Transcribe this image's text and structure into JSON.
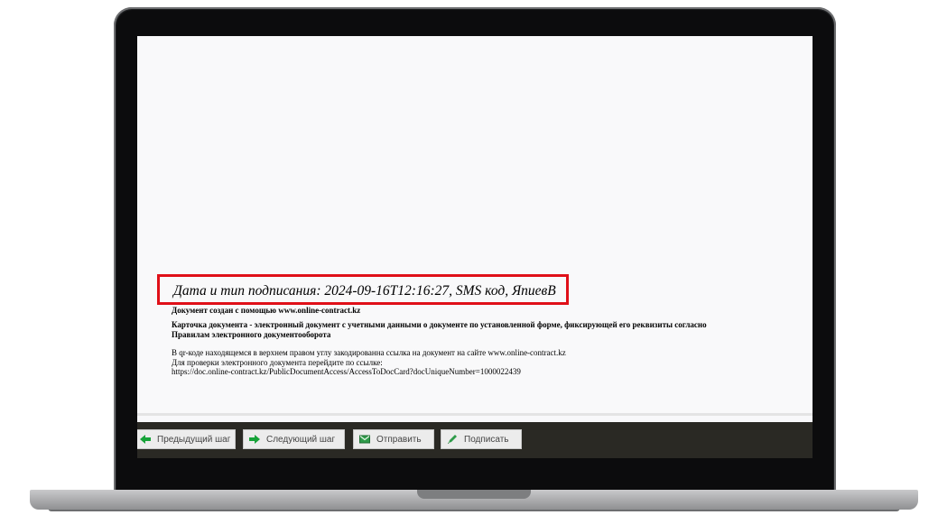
{
  "document": {
    "signature_line": "Дата и тип подписания: 2024-09-16T12:16:27, SMS код, ЯпиевВ",
    "created_with": "Документ создан с помощью www.online-contract.kz",
    "card_description_1": "Карточка документа - электронный документ с учетными данными о документе по установленной форме, фиксирующей его реквизиты согласно",
    "card_description_2": "Правилам электронного документооборота",
    "qr_info": "В qr-коде находящемся в верхнем правом углу закодированна ссылка на документ на сайте www.online-contract.kz",
    "verify_info": "Для проверки электронного документа перейдите по ссылке:",
    "verify_url": "https://doc.online-contract.kz/PublicDocumentAccess/AccessToDocCard?docUniqueNumber=1000022439"
  },
  "toolbar": {
    "prev_label": "Предыдущий шаг",
    "next_label": "Следующий шаг",
    "send_label": "Отправить",
    "sign_label": "Подписать"
  },
  "colors": {
    "highlight_border": "#e01018",
    "toolbar_bg": "#2a2924",
    "arrow_green": "#17a339"
  },
  "icons": {
    "prev": "arrow-left-icon",
    "next": "arrow-right-icon",
    "send": "envelope-icon",
    "sign": "pen-icon"
  }
}
